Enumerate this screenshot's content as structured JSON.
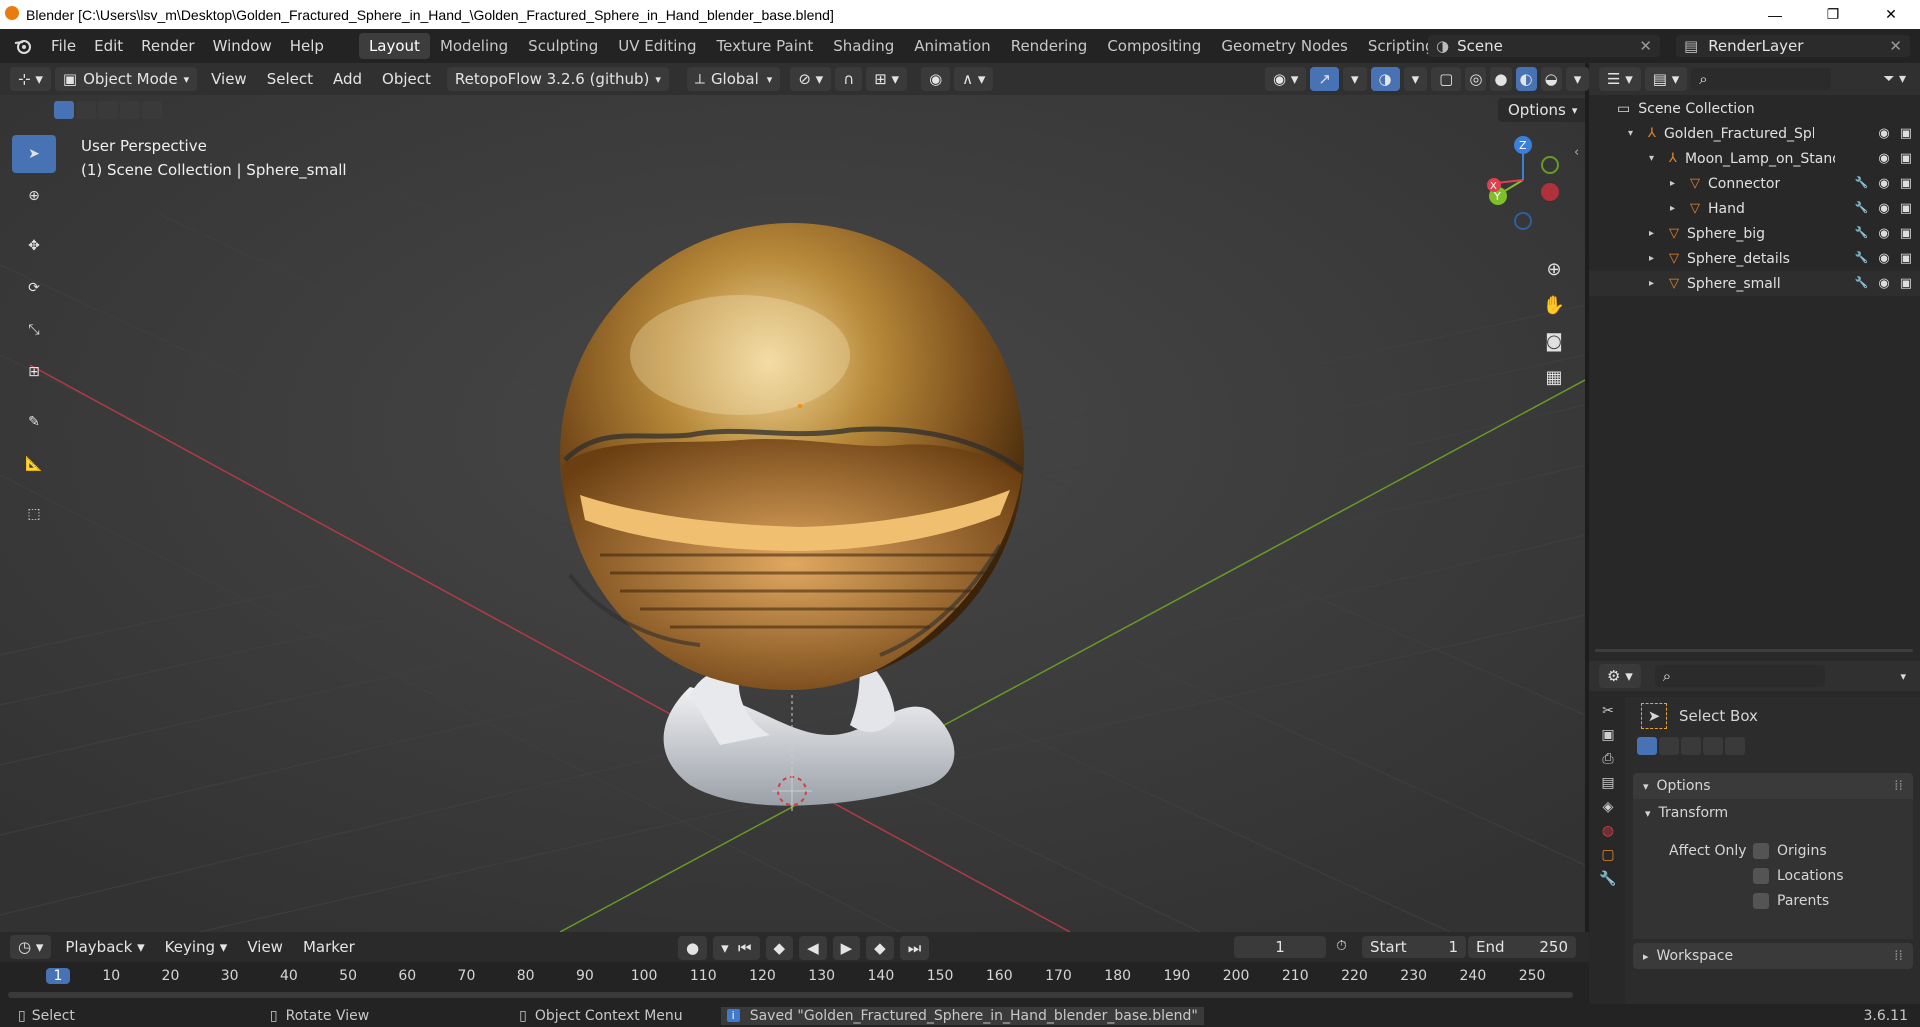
{
  "window": {
    "title": "Blender [C:\\Users\\lsv_m\\Desktop\\Golden_Fractured_Sphere_in_Hand_\\Golden_Fractured_Sphere_in_Hand_blender_base.blend]",
    "minimize": "—",
    "maximize": "❐",
    "close": "✕"
  },
  "menu": [
    "File",
    "Edit",
    "Render",
    "Window",
    "Help"
  ],
  "workspaces": [
    "Layout",
    "Modeling",
    "Sculpting",
    "UV Editing",
    "Texture Paint",
    "Shading",
    "Animation",
    "Rendering",
    "Compositing",
    "Geometry Nodes",
    "Scripting"
  ],
  "active_workspace": "Layout",
  "add_workspace": "+",
  "scene": {
    "name": "Scene",
    "view_layer": "RenderLayer"
  },
  "viewport_header": {
    "mode": "Object Mode",
    "menus": [
      "View",
      "Select",
      "Add",
      "Object"
    ],
    "addon": "RetopoFlow 3.2.6 (github)",
    "orientation": "Global",
    "options": "Options"
  },
  "viewport": {
    "perspective": "User Perspective",
    "collection_info": "(1) Scene Collection | Sphere_small",
    "gizmo_axes": {
      "z": "Z",
      "y": "Y",
      "x": "X"
    }
  },
  "outliner": {
    "root": "Scene Collection",
    "items": [
      {
        "label": "Golden_Fractured_Sphere",
        "indent": 1,
        "icon": "empty-icon"
      },
      {
        "label": "Moon_Lamp_on_Stand",
        "indent": 2,
        "icon": "empty-icon"
      },
      {
        "label": "Connector",
        "indent": 3,
        "icon": "mesh-icon"
      },
      {
        "label": "Hand",
        "indent": 3,
        "icon": "mesh-icon"
      },
      {
        "label": "Sphere_big",
        "indent": 2,
        "icon": "mesh-icon"
      },
      {
        "label": "Sphere_details",
        "indent": 2,
        "icon": "mesh-icon"
      },
      {
        "label": "Sphere_small",
        "indent": 2,
        "icon": "mesh-icon"
      }
    ]
  },
  "properties": {
    "tool_name": "Select Box",
    "options_panel": "Options",
    "transform_panel": "Transform",
    "affect_only": "Affect Only",
    "checkboxes": [
      "Origins",
      "Locations",
      "Parents"
    ],
    "workspace_panel": "Workspace"
  },
  "timeline": {
    "menus": [
      "Playback",
      "Keying",
      "View",
      "Marker"
    ],
    "current_frame": "1",
    "start_label": "Start",
    "start": "1",
    "end_label": "End",
    "end": "250",
    "ticks": [
      "1",
      "10",
      "20",
      "30",
      "40",
      "50",
      "60",
      "70",
      "80",
      "90",
      "100",
      "110",
      "120",
      "130",
      "140",
      "150",
      "160",
      "170",
      "180",
      "190",
      "200",
      "210",
      "220",
      "230",
      "240",
      "250"
    ]
  },
  "status": {
    "select": "Select",
    "rotate": "Rotate View",
    "context": "Object Context Menu",
    "message": "Saved \"Golden_Fractured_Sphere_in_Hand_blender_base.blend\"",
    "version": "3.6.11"
  },
  "colors": {
    "accent": "#4772b3",
    "mesh_orange": "#e8852a",
    "wrench_blue": "#6e9ee6",
    "x_axis": "#e03f4f",
    "y_axis": "#7fbf2a",
    "z_axis": "#3b7fd9"
  }
}
